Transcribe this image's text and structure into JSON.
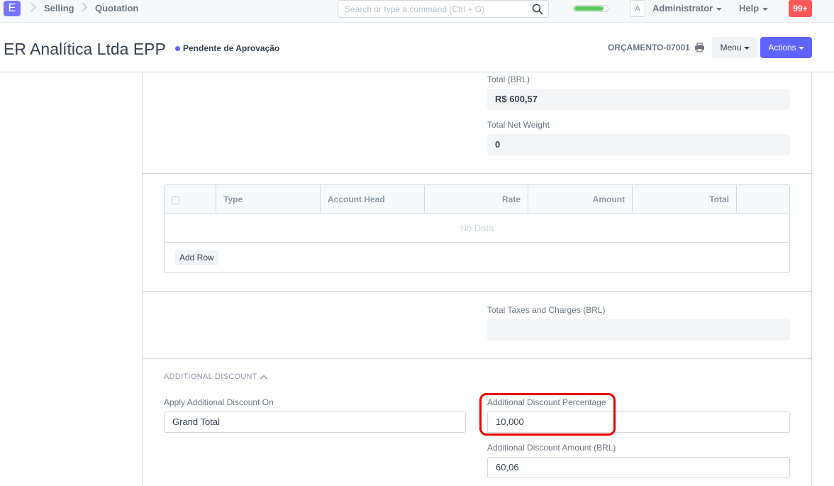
{
  "navbar": {
    "logo_letter": "E",
    "breadcrumbs": [
      "Selling",
      "Quotation"
    ],
    "search_placeholder": "Search or type a command (Ctrl + G)",
    "progress_fraction": 0.9,
    "progress_color": "#5cc85c",
    "avatar_letter": "A",
    "user_label": "Administrator",
    "help_label": "Help",
    "notifications_label": "99+"
  },
  "page": {
    "title": "ER Analítica Ltda EPP",
    "status": "Pendente de Aprovação",
    "status_color": "#5e64ff",
    "doc_name": "ORÇAMENTO-07001",
    "menu_label": "Menu",
    "actions_label": "Actions"
  },
  "totals": {
    "total_label": "Total (BRL)",
    "total_value": "R$ 600,57",
    "net_weight_label": "Total Net Weight",
    "net_weight_value": "0"
  },
  "taxes_table": {
    "columns": [
      "Type",
      "Account Head",
      "Rate",
      "Amount",
      "Total"
    ],
    "empty_text": "No Data",
    "add_row_label": "Add Row"
  },
  "taxes_total": {
    "label": "Total Taxes and Charges (BRL)",
    "value": ""
  },
  "additional_discount": {
    "section_title": "ADDITIONAL DISCOUNT",
    "apply_on_label": "Apply Additional Discount On",
    "apply_on_value": "Grand Total",
    "percentage_label": "Additional Discount Percentage",
    "percentage_value": "10,000",
    "amount_label": "Additional Discount Amount (BRL)",
    "amount_value": "60,06"
  }
}
